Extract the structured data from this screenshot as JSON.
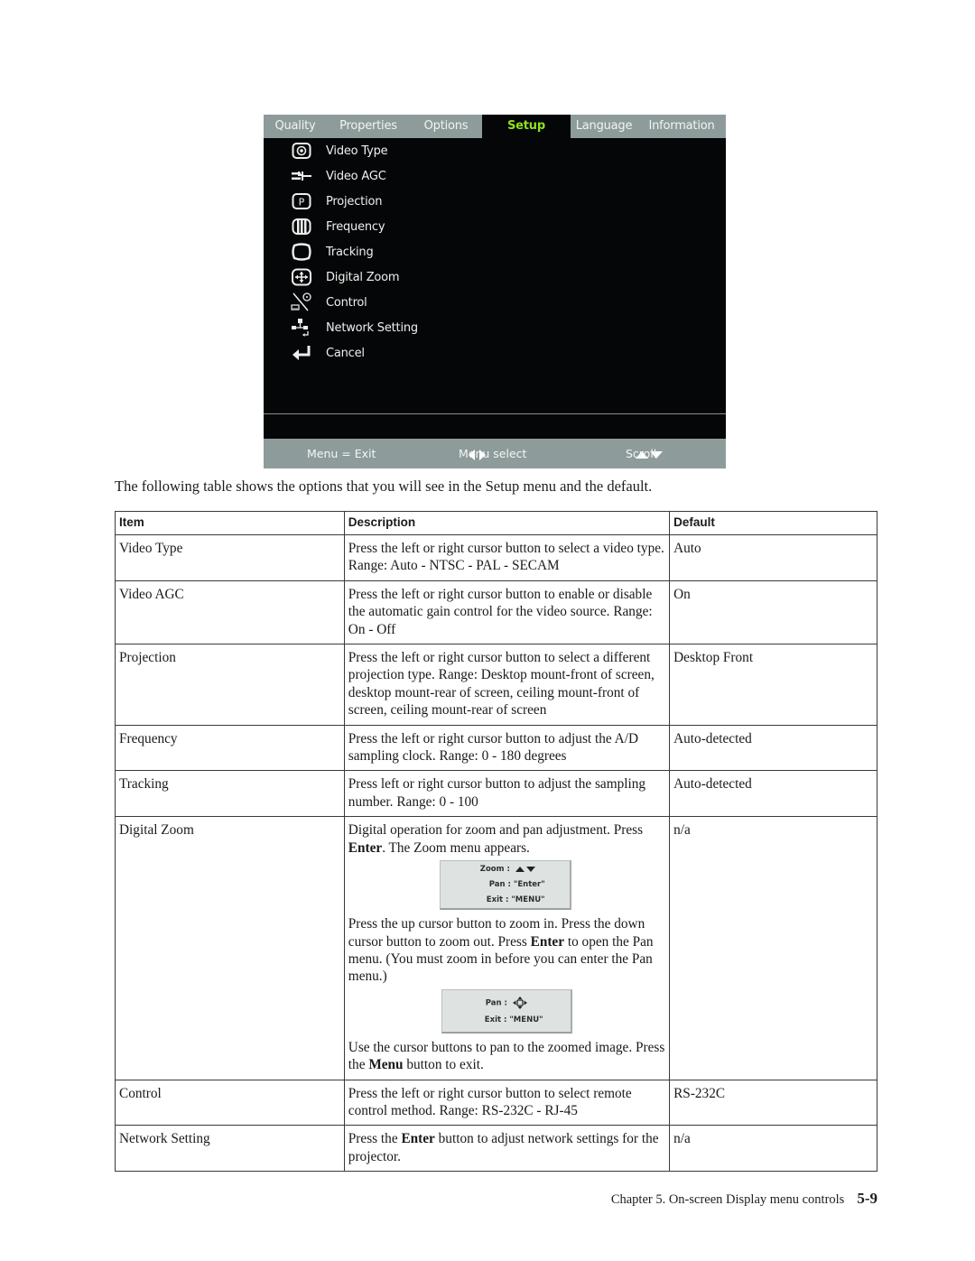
{
  "osd_menu": {
    "tabs": [
      {
        "label": "Quality",
        "active": false
      },
      {
        "label": "Properties",
        "active": false
      },
      {
        "label": "Options",
        "active": false
      },
      {
        "label": "Setup",
        "active": true
      },
      {
        "label": "Language",
        "active": false
      },
      {
        "label": "Information",
        "active": false
      }
    ],
    "items": [
      {
        "label": "Video Type",
        "icon": "video-type-icon"
      },
      {
        "label": "Video AGC",
        "icon": "video-agc-icon"
      },
      {
        "label": "Projection",
        "icon": "projection-icon"
      },
      {
        "label": "Frequency",
        "icon": "frequency-icon"
      },
      {
        "label": "Tracking",
        "icon": "tracking-icon"
      },
      {
        "label": "Digital Zoom",
        "icon": "digital-zoom-icon"
      },
      {
        "label": "Control",
        "icon": "control-icon"
      },
      {
        "label": "Network Setting",
        "icon": "network-setting-icon"
      },
      {
        "label": "Cancel",
        "icon": "return-arrow-icon"
      }
    ],
    "footer": {
      "exit_hint": "Menu = Exit",
      "select_hint": "Menu select",
      "scroll_hint": "Scroll"
    },
    "colors": {
      "active_tab_text": "#8ee020",
      "bar_background": "#8d9c9a",
      "panel_background": "#050607"
    }
  },
  "intro_text": "The following table shows the options that you will see in the Setup menu and the default.",
  "table": {
    "headers": {
      "item": "Item",
      "description": "Description",
      "default": "Default"
    },
    "rows": [
      {
        "item": "Video Type",
        "description": "Press the left or right cursor button to select a video type. Range: Auto - NTSC - PAL - SECAM",
        "default": "Auto"
      },
      {
        "item": "Video AGC",
        "description": "Press the left or right cursor button to enable or disable the automatic gain control for the video source. Range: On - Off",
        "default": "On"
      },
      {
        "item": "Projection",
        "description": "Press the left or right cursor button to select a different projection type. Range: Desktop mount-front of screen, desktop mount-rear of screen, ceiling mount-front of screen, ceiling mount-rear of screen",
        "default": "Desktop Front"
      },
      {
        "item": "Frequency",
        "description": "Press the left or right cursor button to adjust the A/D sampling clock. Range: 0 - 180 degrees",
        "default": "Auto-detected"
      },
      {
        "item": "Tracking",
        "description": "Press left or right cursor button to adjust the sampling number. Range: 0 - 100",
        "default": "Auto-detected"
      },
      {
        "item": "Digital Zoom",
        "description_parts": {
          "p1_a": "Digital operation for zoom and pan adjustment. Press ",
          "p1_bold": "Enter",
          "p1_b": ". The Zoom menu appears.",
          "zoom_box": {
            "line1": "Zoom :",
            "line2": "Pan : \"Enter\"",
            "line3": "Exit : \"MENU\""
          },
          "p2_a": "Press the up cursor button to zoom in. Press the down cursor button to zoom out. Press ",
          "p2_bold": "Enter",
          "p2_b": " to open the Pan menu. (You must zoom in before you can enter the Pan menu.)",
          "pan_box": {
            "line1": "Pan :",
            "line2": "Exit : \"MENU\""
          },
          "p3_a": "Use the cursor buttons to pan to the zoomed image. Press the ",
          "p3_bold": "Menu",
          "p3_b": " button to exit."
        },
        "default": "n/a"
      },
      {
        "item": "Control",
        "description": "Press the left or right cursor button to select remote control method. Range: RS-232C - RJ-45",
        "default": "RS-232C"
      },
      {
        "item": "Network Setting",
        "description_parts": {
          "a": "Press the ",
          "bold": "Enter",
          "b": " button to adjust network settings for the projector."
        },
        "default": "n/a"
      }
    ]
  },
  "page_footer": {
    "chapter": "Chapter 5. On-screen Display menu controls",
    "page_number": "5-9"
  }
}
